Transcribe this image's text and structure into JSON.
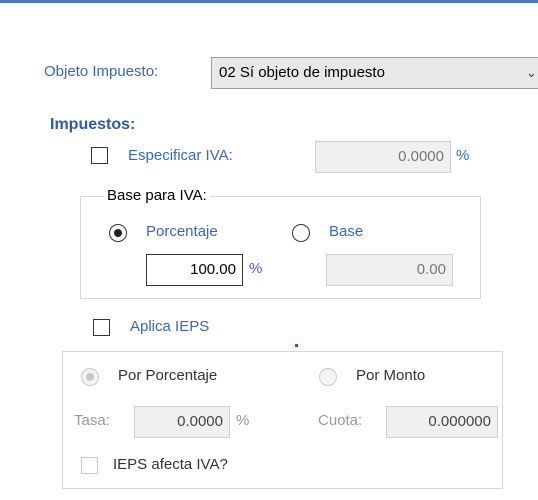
{
  "objeto_impuesto": {
    "label": "Objeto Impuesto:",
    "value": "02 Sí objeto de impuesto",
    "arrow": "chevron-down"
  },
  "impuestos_heading": "Impuestos:",
  "especificar_iva": {
    "label": "Especificar IVA:",
    "checked": false,
    "value": "0.0000",
    "unit": "%"
  },
  "base_iva_group": {
    "legend": "Base para IVA:",
    "porcentaje": {
      "label": "Porcentaje",
      "selected": true
    },
    "base": {
      "label": "Base",
      "selected": false
    },
    "porcentaje_value": "100.00",
    "porcentaje_unit": "%",
    "base_value": "0.00"
  },
  "aplica_ieps": {
    "label": "Aplica IEPS",
    "checked": false
  },
  "ieps_group": {
    "por_porcentaje": {
      "label": "Por Porcentaje",
      "selected": true
    },
    "por_monto": {
      "label": "Por Monto",
      "selected": false
    },
    "tasa_label": "Tasa:",
    "tasa_value": "0.0000",
    "tasa_unit": "%",
    "cuota_label": "Cuota:",
    "cuota_value": "0.000000",
    "afecta_iva": {
      "label": "IEPS afecta IVA?",
      "checked": false
    }
  },
  "colors": {
    "accent": "#3a67b8",
    "top_border": "#4a7bb7",
    "disabled": "#9a9a9a",
    "error_dot": "#e02020"
  }
}
